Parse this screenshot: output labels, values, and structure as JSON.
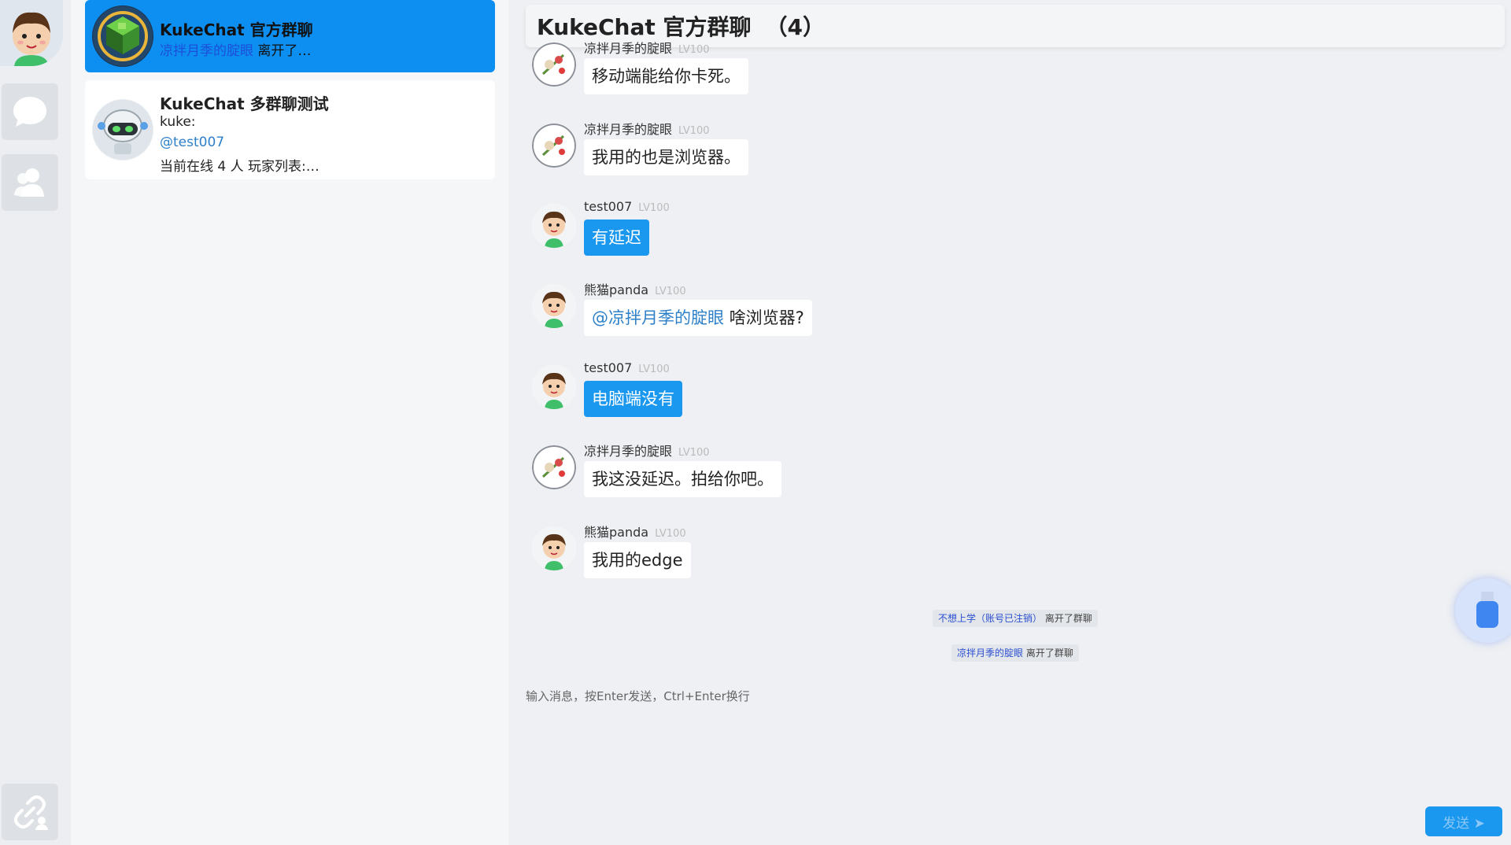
{
  "rail": {
    "avatar_icon": "boy-avatar-icon",
    "buttons": [
      {
        "icon": "chat-bubble-icon"
      },
      {
        "icon": "contacts-icon"
      },
      {
        "icon": "link-user-icon"
      }
    ]
  },
  "conversations": [
    {
      "title": "KukeChat 官方群聊",
      "preview_user": "凉拌月季的腚眼",
      "preview_text": "离开了…",
      "active": true
    },
    {
      "title": "KukeChat 多群聊测试",
      "line1": "kuke:",
      "line2": "@test007",
      "line3": "当前在线 4 人 玩家列表:…",
      "active": false
    }
  ],
  "chat": {
    "title": "KukeChat 官方群聊",
    "count": "（4）",
    "messages": [
      {
        "name": "凉拌月季的腚眼",
        "level": "LV100",
        "text": "移动端能给你卡死。",
        "mine": false,
        "avatar": "rose-avatar-icon"
      },
      {
        "name": "凉拌月季的腚眼",
        "level": "LV100",
        "text": "我用的也是浏览器。",
        "mine": false,
        "avatar": "rose-avatar-icon"
      },
      {
        "name": "test007",
        "level": "LV100",
        "text": "有延迟",
        "mine": true,
        "avatar": "boy-avatar-icon"
      },
      {
        "name": "熊猫panda",
        "level": "LV100",
        "mention": "@凉拌月季的腚眼",
        "text": " 啥浏览器?",
        "mine": false,
        "avatar": "boy-avatar-icon"
      },
      {
        "name": "test007",
        "level": "LV100",
        "text": "电脑端没有",
        "mine": true,
        "avatar": "boy-avatar-icon"
      },
      {
        "name": "凉拌月季的腚眼",
        "level": "LV100",
        "text": "我这没延迟。拍给你吧。",
        "mine": false,
        "avatar": "rose-avatar-icon"
      },
      {
        "name": "熊猫panda",
        "level": "LV100",
        "text": "我用的edge",
        "mine": false,
        "avatar": "boy-avatar-icon"
      }
    ],
    "notices": [
      {
        "user": "不想上学（账号已注销）",
        "text": "离开了群聊"
      },
      {
        "user": "凉拌月季的腚眼",
        "text": "离开了群聊"
      }
    ],
    "input_placeholder": "输入消息，按Enter发送，Ctrl+Enter换行",
    "send_label": "发送 ➤"
  },
  "colors": {
    "accent": "#0d8ff2",
    "bubble_mine": "#1a97ef",
    "mention": "#2e80c9"
  }
}
